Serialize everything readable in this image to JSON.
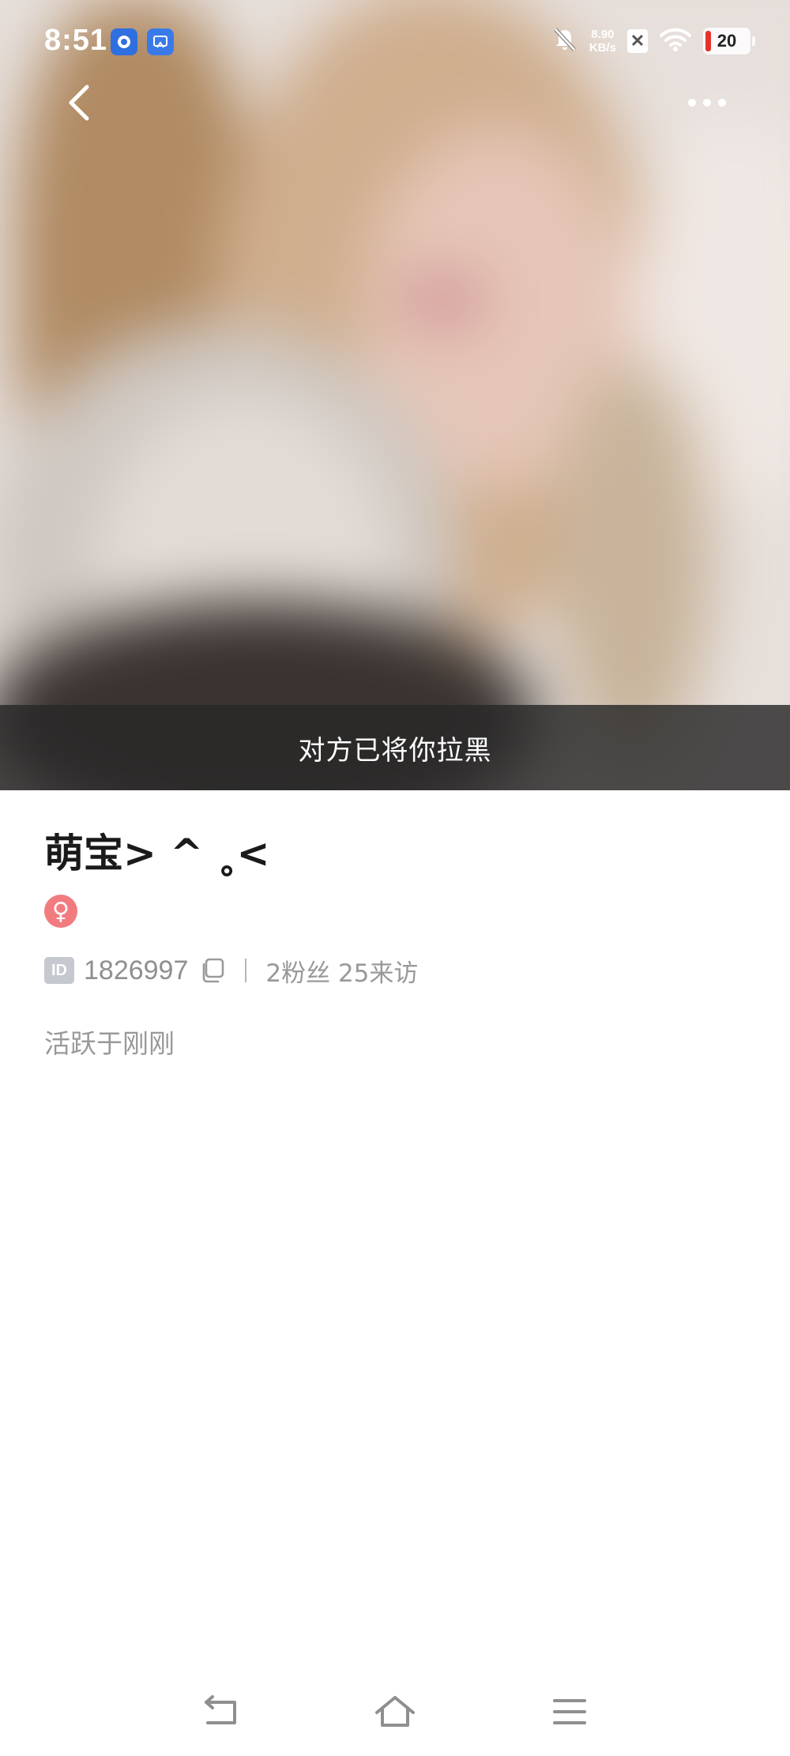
{
  "status_bar": {
    "time": "8:51",
    "net_speed_value": "8.90",
    "net_speed_unit": "KB/s",
    "battery": "20",
    "icons": [
      "app-icon",
      "screenshot-icon",
      "bell-off-icon",
      "sim-x-icon",
      "wifi-icon",
      "battery-icon"
    ]
  },
  "nav": {
    "back_icon": "chevron-left-icon",
    "more_icon": "more-dots-icon"
  },
  "banner": {
    "blocked_text": "对方已将你拉黑"
  },
  "profile": {
    "nickname": "萌宝> ^ ˳<",
    "gender_symbol": "♀",
    "id_label": "ID",
    "user_id": "1826997",
    "stats_text": "2粉丝 25来访",
    "active_status": "活跃于刚刚"
  },
  "colors": {
    "banner_bg": "#282828",
    "gender_female": "#f27b80",
    "muted_text": "#999999",
    "battery_low": "#e2342c"
  }
}
